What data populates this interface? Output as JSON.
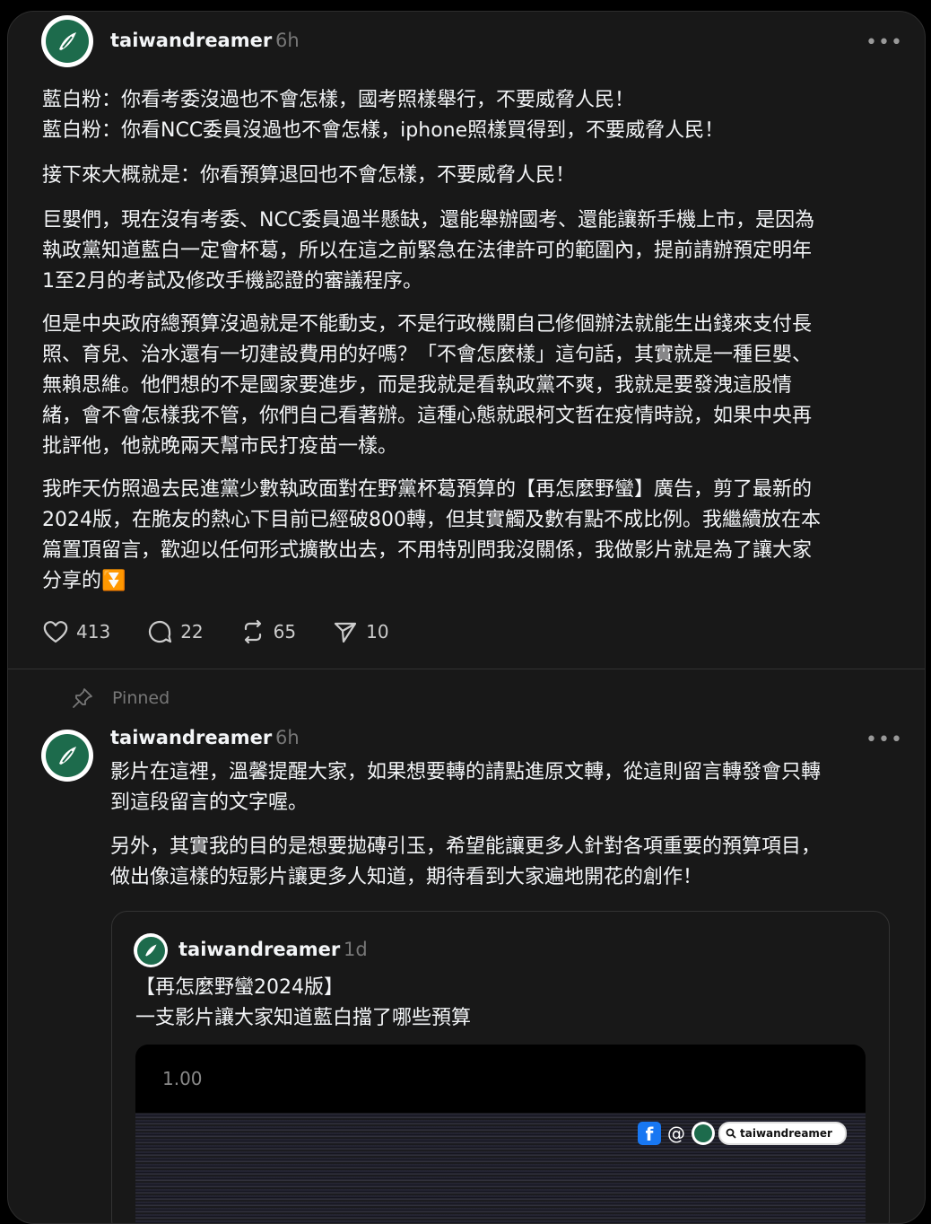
{
  "post": {
    "username": "taiwandreamer",
    "time": "6h",
    "more": "•••",
    "paragraphs": [
      [
        "藍白粉：你看考委沒過也不會怎樣，國考照樣舉行，不要威脅人民！",
        "藍白粉：你看NCC委員沒過也不會怎樣，iphone照樣買得到，不要威脅人民！"
      ],
      [
        "接下來大概就是：你看預算退回也不會怎樣，不要威脅人民！"
      ],
      [
        "巨嬰們，現在沒有考委、NCC委員過半懸缺，還能舉辦國考、還能讓新手機上市，是因為",
        "執政黨知道藍白一定會杯葛，所以在這之前緊急在法律許可的範圍內，提前請辦預定明年",
        "1至2月的考試及修改手機認證的審議程序。"
      ],
      [
        "但是中央政府總預算沒過就是不能動支，不是行政機關自己修個辦法就能生出錢來支付長",
        "照、育兒、治水還有一切建設費用的好嗎？「不會怎麼樣」這句話，其實就是一種巨嬰、",
        "無賴思維。他們想的不是國家要進步，而是我就是看執政黨不爽，我就是要發洩這股情",
        "緒，會不會怎樣我不管，你們自己看著辦。這種心態就跟柯文哲在疫情時說，如果中央再",
        "批評他，他就晚兩天幫市民打疫苗一樣。"
      ],
      [
        "我昨天仿照過去民進黨少數執政面對在野黨杯葛預算的【再怎麼野蠻】廣告，剪了最新的",
        "2024版，在脆友的熱心下目前已經破800轉，但其實觸及數有點不成比例。我繼續放在本",
        "篇置頂留言，歡迎以任何形式擴散出去，不用特別問我沒關係，我做影片就是為了讓大家",
        "分享的⏬"
      ]
    ],
    "likes": "413",
    "replies": "22",
    "reposts": "65",
    "shares": "10"
  },
  "pinned_label": "Pinned",
  "reply": {
    "username": "taiwandreamer",
    "time": "6h",
    "more": "•••",
    "paragraphs": [
      [
        "影片在這裡，溫馨提醒大家，如果想要轉的請點進原文轉，從這則留言轉發會只轉",
        "到這段留言的文字喔。"
      ],
      [
        "另外，其實我的目的是想要拋磚引玉，希望能讓更多人針對各項重要的預算項目，",
        "做出像這樣的短影片讓更多人知道，期待看到大家遍地開花的創作！"
      ]
    ]
  },
  "quote": {
    "username": "taiwandreamer",
    "time": "1d",
    "lines": [
      "【再怎麼野蠻2024版】",
      "一支影片讓大家知道藍白擋了哪些預算"
    ],
    "video_speed": "1.00",
    "video_overlay_search": "taiwandreamer",
    "video_overlay_fb": "f",
    "video_overlay_threads": "@"
  }
}
